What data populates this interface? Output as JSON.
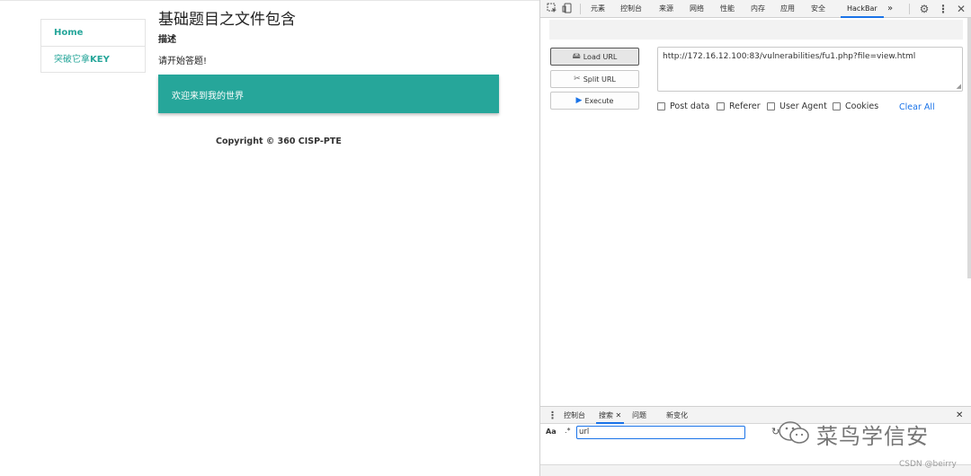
{
  "page": {
    "nav": {
      "home": "Home",
      "key_prefix": "突破它拿",
      "key_suffix": "KEY"
    },
    "title": "基础题目之文件包含",
    "desc_heading": "描述",
    "prompt": "请开始答题!",
    "banner_text": "欢迎来到我的世界",
    "copyright": "Copyright © 360 CISP-PTE"
  },
  "devtools": {
    "tabs": [
      "元素",
      "控制台",
      "来源",
      "网络",
      "性能",
      "内存",
      "应用",
      "安全",
      "HackBar"
    ],
    "active_tab": "HackBar",
    "more": "»",
    "hackbar": {
      "load_url": "Load URL",
      "split_url": "Split URL",
      "execute": "Execute",
      "url": "http://172.16.12.100:83/vulnerabilities/fu1.php?file=view.html",
      "options": [
        "Post data",
        "Referer",
        "User Agent",
        "Cookies"
      ],
      "clear_all": "Clear All"
    },
    "drawer": {
      "tabs": [
        "控制台",
        "搜索",
        "问题",
        "新变化"
      ],
      "active_tab": "搜索",
      "case_toggle": "Aa",
      "regex_toggle": ".*",
      "search_value": "url"
    }
  },
  "watermark": {
    "wechat_name": "菜鸟学信安",
    "csdn": "CSDN @beirry"
  },
  "colors": {
    "accent": "#26a69a",
    "link": "#1a73e8"
  }
}
